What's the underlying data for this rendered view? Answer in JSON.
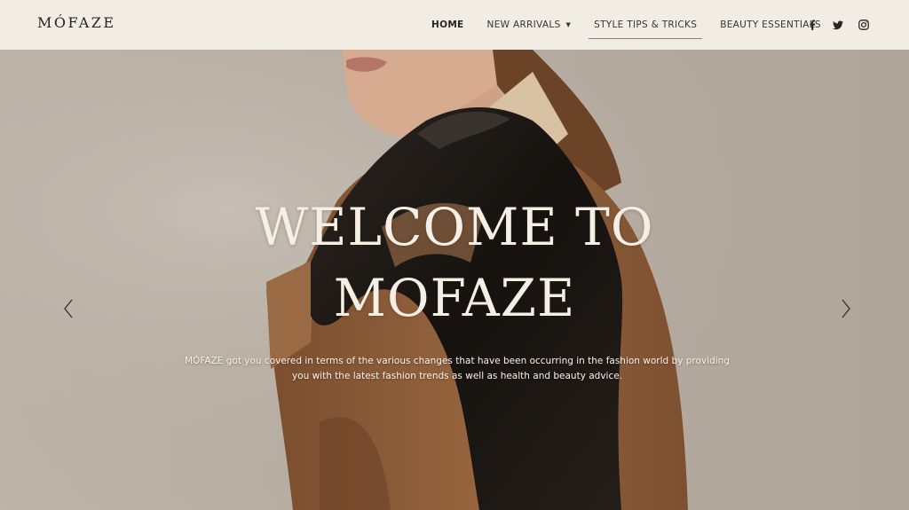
{
  "header": {
    "logo": "MÓFAZE",
    "nav": [
      {
        "label": "HOME"
      },
      {
        "label": "NEW ARRIVALS"
      },
      {
        "label": "STYLE TIPS & TRICKS"
      },
      {
        "label": "BEAUTY ESSENTIALS"
      }
    ],
    "social": [
      "facebook-icon",
      "twitter-icon",
      "instagram-icon"
    ]
  },
  "hero": {
    "title_line1": "WELCOME TO",
    "title_line2": "MOFAZE",
    "description": "MÓFAZE got you covered in terms of the various changes that have been occurring in the fashion world by providing you with the latest fashion trends as well as health and beauty advice.",
    "prev_icon": "chevron-left-icon",
    "next_icon": "chevron-right-icon"
  },
  "colors": {
    "header_bg": "#f1ece4",
    "hero_bg": "#b6aca2",
    "coat": "#8a5a36",
    "scarf": "#1e1a17"
  }
}
